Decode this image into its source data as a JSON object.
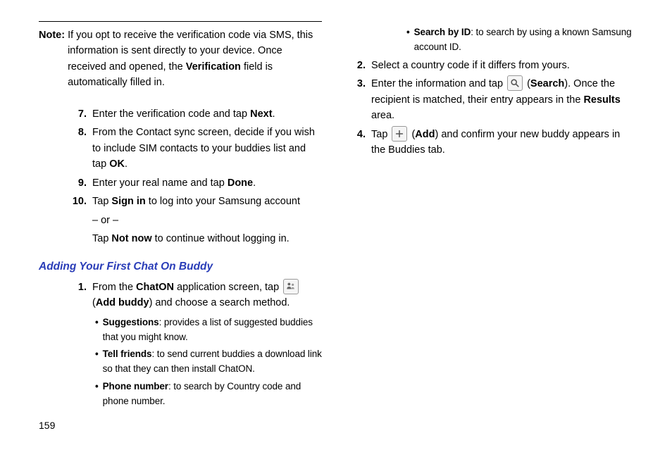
{
  "pageNumber": "159",
  "leftColumn": {
    "note": {
      "label": "Note:",
      "text_parts": [
        "If you opt to receive the verification code via SMS, this information is sent directly to your device. Once received and opened, the ",
        "Verification",
        " field is automatically filled in."
      ]
    },
    "steps": {
      "s7": {
        "num": "7.",
        "parts": [
          "Enter the verification code and tap ",
          "Next",
          "."
        ]
      },
      "s8": {
        "num": "8.",
        "parts": [
          "From the Contact sync screen, decide if you wish to include SIM contacts to your buddies list and tap ",
          "OK",
          "."
        ]
      },
      "s9": {
        "num": "9.",
        "parts": [
          "Enter your real name and tap ",
          "Done",
          "."
        ]
      },
      "s10": {
        "num": "10.",
        "parts": [
          "Tap ",
          "Sign in",
          " to log into your Samsung account"
        ],
        "or": "– or –",
        "cont_parts": [
          "Tap ",
          "Not now",
          " to continue without logging in."
        ]
      }
    },
    "heading": "Adding Your First Chat On Buddy",
    "addSteps": {
      "s1": {
        "num": "1.",
        "pre": "From the ",
        "app": "ChatON",
        "mid": " application screen, tap ",
        "iconLabel_open": " (",
        "iconBold": "Add buddy",
        "iconLabel_close": ") and choose a search method."
      }
    },
    "bullets": {
      "b1": {
        "label": "Suggestions",
        "rest": ": provides a list of suggested buddies that you might know."
      },
      "b2": {
        "label": "Tell friends",
        "rest": ": to send current buddies a download link so that they can then install ChatON."
      },
      "b3": {
        "label": "Phone number",
        "rest": ": to search by Country code and phone number."
      }
    }
  },
  "rightColumn": {
    "bullets": {
      "b1": {
        "label": "Search by ID",
        "rest": ": to search by using a known Samsung account ID."
      }
    },
    "steps": {
      "s2": {
        "num": "2.",
        "text": "Select a country code if it differs from yours."
      },
      "s3": {
        "num": "3.",
        "pre": "Enter the information and tap ",
        "iconLabel_open": " (",
        "iconBold": "Search",
        "iconLabel_close": "). Once the recipient is matched, their entry appears in the ",
        "boldTail": "Results",
        "tail": " area."
      },
      "s4": {
        "num": "4.",
        "pre": "Tap ",
        "iconLabel_open": " (",
        "iconBold": "Add",
        "iconLabel_close": ") and confirm your new buddy appears in the Buddies tab."
      }
    }
  }
}
